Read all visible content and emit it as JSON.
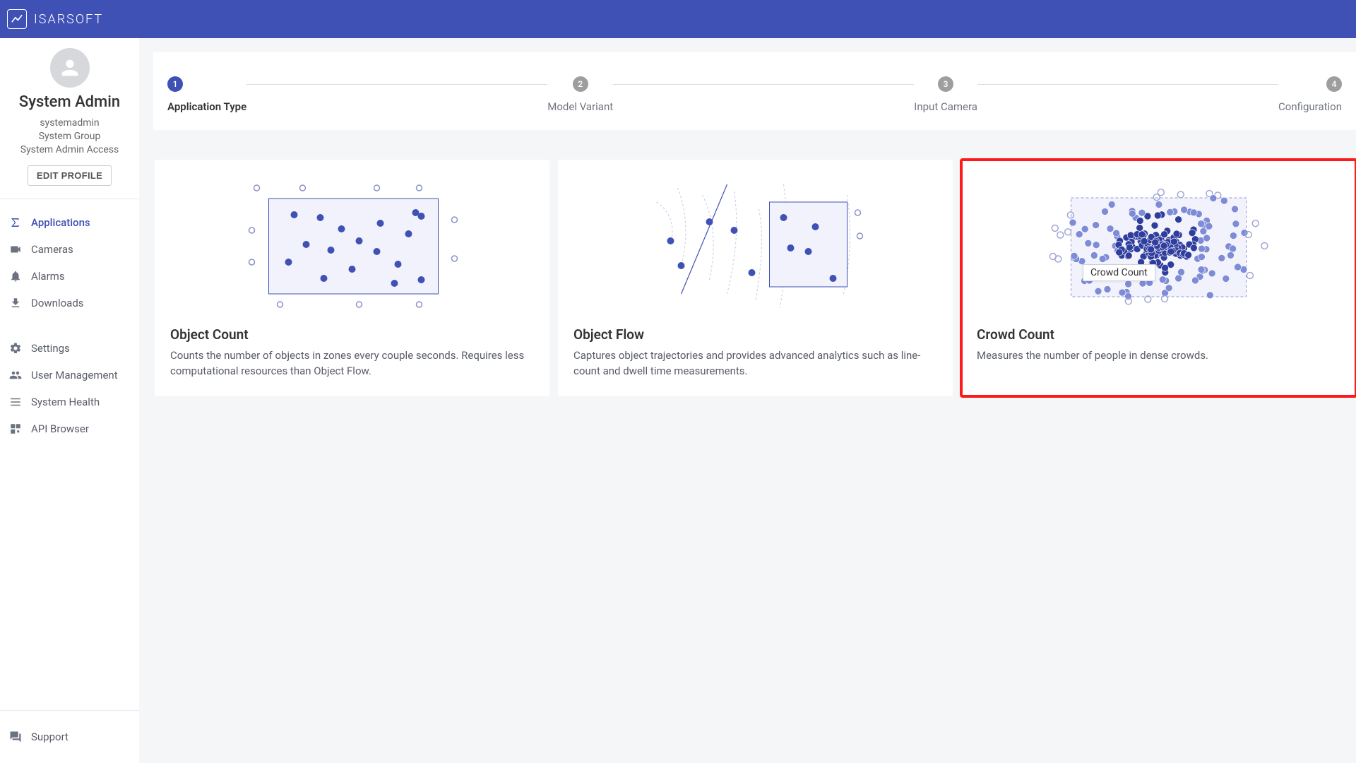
{
  "brand": "ISARSOFT",
  "profile": {
    "name": "System Admin",
    "username": "systemadmin",
    "group": "System Group",
    "access": "System Admin Access",
    "edit_label": "EDIT PROFILE"
  },
  "nav": {
    "applications": "Applications",
    "cameras": "Cameras",
    "alarms": "Alarms",
    "downloads": "Downloads",
    "settings": "Settings",
    "user_management": "User Management",
    "system_health": "System Health",
    "api_browser": "API Browser",
    "support": "Support"
  },
  "stepper": {
    "steps": [
      {
        "num": "1",
        "label": "Application Type"
      },
      {
        "num": "2",
        "label": "Model Variant"
      },
      {
        "num": "3",
        "label": "Input Camera"
      },
      {
        "num": "4",
        "label": "Configuration"
      }
    ]
  },
  "cards": {
    "object_count": {
      "title": "Object Count",
      "desc": "Counts the number of objects in zones every couple seconds. Requires less computational resources than Object Flow."
    },
    "object_flow": {
      "title": "Object Flow",
      "desc": "Captures object trajectories and provides advanced analytics such as line-count and dwell time measurements."
    },
    "crowd_count": {
      "title": "Crowd Count",
      "desc": "Measures the number of people in dense crowds.",
      "tooltip": "Crowd Count"
    }
  }
}
